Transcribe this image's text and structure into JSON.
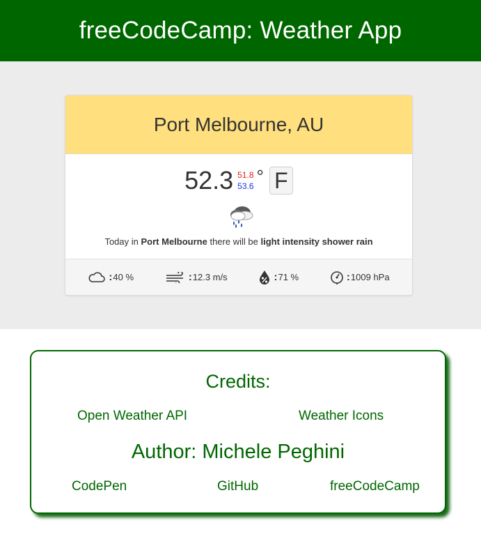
{
  "header": {
    "title": "freeCodeCamp: Weather App"
  },
  "weather": {
    "location": "Port Melbourne, AU",
    "temp": "52.3",
    "temp_max": "51.8",
    "temp_min": "53.6",
    "degree_symbol": "°",
    "unit": "F",
    "icon": "rain-cloud-icon",
    "summary": {
      "prefix": "Today in",
      "city": "Port Melbourne",
      "middle": "there will be",
      "condition": "light intensity shower rain"
    },
    "stats": {
      "clouds": "40 %",
      "wind": "12.3 m/s",
      "humidity": "71 %",
      "pressure": "1009 hPa"
    },
    "colors": {
      "header_bg": "#006600",
      "card_head_bg": "#ffdf7e",
      "max_color": "#e0201b",
      "min_color": "#1a35e0"
    }
  },
  "credits": {
    "title": "Credits:",
    "links": [
      "Open Weather API",
      "Weather Icons"
    ],
    "author": "Author: Michele Peghini",
    "profiles": [
      "CodePen",
      "GitHub",
      "freeCodeCamp"
    ]
  }
}
